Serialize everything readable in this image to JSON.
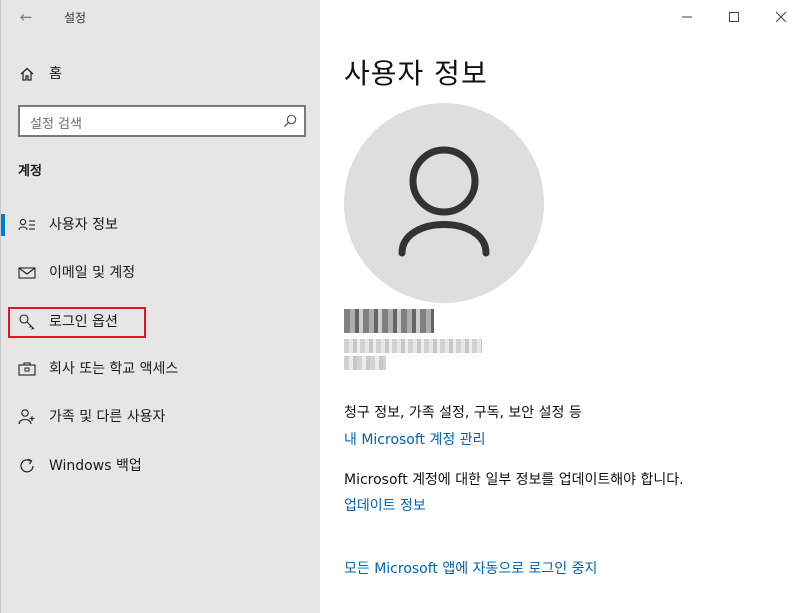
{
  "window": {
    "title": "설정"
  },
  "sidebar": {
    "home_label": "홈",
    "search_placeholder": "설정 검색",
    "section_header": "계정",
    "items": [
      {
        "label": "사용자 정보",
        "icon": "user-info-icon",
        "active": true
      },
      {
        "label": "이메일 및 계정",
        "icon": "mail-icon",
        "active": false
      },
      {
        "label": "로그인 옵션",
        "icon": "key-icon",
        "active": false,
        "highlighted": true
      },
      {
        "label": "회사 또는 학교 액세스",
        "icon": "briefcase-icon",
        "active": false
      },
      {
        "label": "가족 및 다른 사용자",
        "icon": "person-add-icon",
        "active": false
      },
      {
        "label": "Windows 백업",
        "icon": "sync-icon",
        "active": false
      }
    ]
  },
  "main": {
    "title": "사용자 정보",
    "billing_info": "청구 정보, 가족 설정, 구독, 보안 설정 등",
    "manage_account_link": "내 Microsoft 계정 관리",
    "update_notice": "Microsoft 계정에 대한 일부 정보를 업데이트해야 합니다.",
    "update_link": "업데이트 정보",
    "stop_signin_link": "모든 Microsoft 앱에 자동으로 로그인 중지"
  },
  "colors": {
    "accent": "#0078d7",
    "link": "#0063b1",
    "highlight": "#e81123",
    "sidebar_bg": "#e6e6e6"
  }
}
